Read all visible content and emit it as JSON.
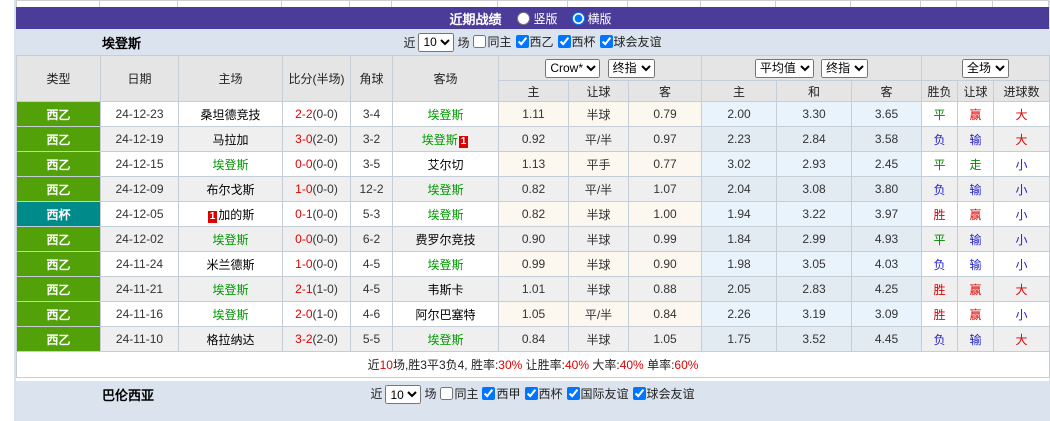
{
  "colors": {
    "header_purple": "#4c3c9a",
    "league_green": "#53a109",
    "cup_teal": "#008b8b",
    "win_red": "#e10000",
    "lose_blue": "#2222cc",
    "draw_green": "#008800",
    "avg_col_bg": "#e9f3fb",
    "odds_col_bg": "#fcf8f0",
    "focus_team_green": "#009900"
  },
  "color_map": {
    "胜": "red",
    "赢": "red",
    "大": "red",
    "负": "blue",
    "输": "blue",
    "小": "blue",
    "平": "green",
    "走": "green"
  },
  "title_bar": {
    "title": "近期战绩",
    "radio_vertical": "竖版",
    "radio_horizontal": "横版",
    "selected": "横版"
  },
  "team_section": {
    "team": "埃登斯",
    "near_label": "近",
    "games_count": "10",
    "games_label": "场",
    "filters": [
      {
        "label": "同主",
        "checked": false
      },
      {
        "label": "西乙",
        "checked": true
      },
      {
        "label": "西杯",
        "checked": true
      },
      {
        "label": "球会友谊",
        "checked": true
      }
    ]
  },
  "table": {
    "columns": [
      "类型",
      "日期",
      "主场",
      "比分(半场)",
      "角球",
      "客场"
    ],
    "sub_columns": [
      "主",
      "让球",
      "客",
      "主",
      "和",
      "客",
      "胜负",
      "让球",
      "进球数"
    ],
    "dropdowns": {
      "bookmaker": "Crow*",
      "bookmaker_stage": "终指",
      "average": "平均值",
      "average_stage": "终指",
      "fulltime": "全场"
    },
    "matches": [
      {
        "type": "西乙",
        "type_color": "#53a109",
        "date": "24-12-23",
        "home": "桑坦德竞技",
        "home_hl": false,
        "home_badge_pre": "",
        "ft": "2-2",
        "ht": "(0-0)",
        "corner": "3-4",
        "away": "埃登斯",
        "away_hl": true,
        "away_badge": "",
        "o365": [
          "1.11",
          "半球",
          "0.79"
        ],
        "avg": [
          "2.00",
          "3.30",
          "3.65"
        ],
        "res": [
          "平",
          "赢",
          "大"
        ]
      },
      {
        "type": "西乙",
        "type_color": "#53a109",
        "date": "24-12-19",
        "home": "马拉加",
        "home_hl": false,
        "home_badge_pre": "",
        "ft": "3-0",
        "ht": "(2-0)",
        "corner": "3-2",
        "away": "埃登斯",
        "away_hl": true,
        "away_badge": "1",
        "o365": [
          "0.92",
          "平/半",
          "0.97"
        ],
        "avg": [
          "2.23",
          "2.84",
          "3.58"
        ],
        "res": [
          "负",
          "输",
          "大"
        ]
      },
      {
        "type": "西乙",
        "type_color": "#53a109",
        "date": "24-12-15",
        "home": "埃登斯",
        "home_hl": true,
        "home_badge_pre": "",
        "ft": "0-0",
        "ht": "(0-0)",
        "corner": "3-5",
        "away": "艾尔切",
        "away_hl": false,
        "away_badge": "",
        "o365": [
          "1.13",
          "平手",
          "0.77"
        ],
        "avg": [
          "3.02",
          "2.93",
          "2.45"
        ],
        "res": [
          "平",
          "走",
          "小"
        ]
      },
      {
        "type": "西乙",
        "type_color": "#53a109",
        "date": "24-12-09",
        "home": "布尔戈斯",
        "home_hl": false,
        "home_badge_pre": "",
        "ft": "1-0",
        "ht": "(0-0)",
        "corner": "12-2",
        "away": "埃登斯",
        "away_hl": true,
        "away_badge": "",
        "o365": [
          "0.82",
          "平/半",
          "1.07"
        ],
        "avg": [
          "2.04",
          "3.08",
          "3.80"
        ],
        "res": [
          "负",
          "输",
          "小"
        ]
      },
      {
        "type": "西杯",
        "type_color": "#008b8b",
        "date": "24-12-05",
        "home": "加的斯",
        "home_hl": false,
        "home_badge_pre": "1",
        "ft": "0-1",
        "ht": "(0-0)",
        "corner": "5-3",
        "away": "埃登斯",
        "away_hl": true,
        "away_badge": "",
        "o365": [
          "0.82",
          "半球",
          "1.00"
        ],
        "avg": [
          "1.94",
          "3.22",
          "3.97"
        ],
        "res": [
          "胜",
          "赢",
          "小"
        ]
      },
      {
        "type": "西乙",
        "type_color": "#53a109",
        "date": "24-12-02",
        "home": "埃登斯",
        "home_hl": true,
        "home_badge_pre": "",
        "ft": "0-0",
        "ht": "(0-0)",
        "corner": "6-2",
        "away": "费罗尔竞技",
        "away_hl": false,
        "away_badge": "",
        "o365": [
          "0.90",
          "半球",
          "0.99"
        ],
        "avg": [
          "1.84",
          "2.99",
          "4.93"
        ],
        "res": [
          "平",
          "输",
          "小"
        ]
      },
      {
        "type": "西乙",
        "type_color": "#53a109",
        "date": "24-11-24",
        "home": "米兰德斯",
        "home_hl": false,
        "home_badge_pre": "",
        "ft": "1-0",
        "ht": "(0-0)",
        "corner": "4-5",
        "away": "埃登斯",
        "away_hl": true,
        "away_badge": "",
        "o365": [
          "0.99",
          "半球",
          "0.90"
        ],
        "avg": [
          "1.98",
          "3.05",
          "4.03"
        ],
        "res": [
          "负",
          "输",
          "小"
        ]
      },
      {
        "type": "西乙",
        "type_color": "#53a109",
        "date": "24-11-21",
        "home": "埃登斯",
        "home_hl": true,
        "home_badge_pre": "",
        "ft": "2-1",
        "ht": "(1-0)",
        "corner": "4-5",
        "away": "韦斯卡",
        "away_hl": false,
        "away_badge": "",
        "o365": [
          "1.01",
          "半球",
          "0.88"
        ],
        "avg": [
          "2.05",
          "2.83",
          "4.25"
        ],
        "res": [
          "胜",
          "赢",
          "大"
        ]
      },
      {
        "type": "西乙",
        "type_color": "#53a109",
        "date": "24-11-16",
        "home": "埃登斯",
        "home_hl": true,
        "home_badge_pre": "",
        "ft": "2-0",
        "ht": "(1-0)",
        "corner": "4-6",
        "away": "阿尔巴塞特",
        "away_hl": false,
        "away_badge": "",
        "o365": [
          "1.05",
          "平/半",
          "0.84"
        ],
        "avg": [
          "2.26",
          "3.19",
          "3.09"
        ],
        "res": [
          "胜",
          "赢",
          "小"
        ]
      },
      {
        "type": "西乙",
        "type_color": "#53a109",
        "date": "24-11-10",
        "home": "格拉纳达",
        "home_hl": false,
        "home_badge_pre": "",
        "ft": "3-2",
        "ht": "(2-0)",
        "corner": "5-5",
        "away": "埃登斯",
        "away_hl": true,
        "away_badge": "",
        "o365": [
          "0.84",
          "半球",
          "1.05"
        ],
        "avg": [
          "1.75",
          "3.52",
          "4.45"
        ],
        "res": [
          "负",
          "输",
          "大"
        ]
      }
    ]
  },
  "summary": {
    "parts": [
      {
        "t": "近",
        "r": false
      },
      {
        "t": "10",
        "r": true
      },
      {
        "t": "场,胜3平3负4, 胜率:",
        "r": false
      },
      {
        "t": "30%",
        "r": true
      },
      {
        "t": " 让胜率:",
        "r": false
      },
      {
        "t": "40%",
        "r": true
      },
      {
        "t": " 大率:",
        "r": false
      },
      {
        "t": "40%",
        "r": true
      },
      {
        "t": " 单率:",
        "r": false
      },
      {
        "t": "60%",
        "r": true
      }
    ]
  },
  "bottom_section": {
    "team": "巴伦西亚",
    "near_label": "近",
    "games_count": "10",
    "games_label": "场",
    "filters": [
      {
        "label": "同主",
        "checked": false
      },
      {
        "label": "西甲",
        "checked": true
      },
      {
        "label": "西杯",
        "checked": true
      },
      {
        "label": "国际友谊",
        "checked": true
      },
      {
        "label": "球会友谊",
        "checked": true
      }
    ]
  }
}
